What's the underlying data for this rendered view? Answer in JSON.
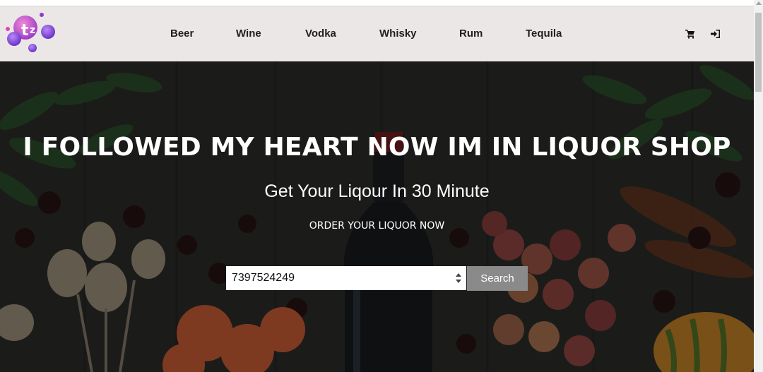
{
  "nav": {
    "links": [
      "Beer",
      "Wine",
      "Vodka",
      "Whisky",
      "Rum",
      "Tequila"
    ],
    "cart_icon": "shopping-cart-icon",
    "login_icon": "sign-in-icon"
  },
  "hero": {
    "title": "I FOLLOWED MY HEART NOW IM IN LIQUOR SHOP",
    "subtitle": "Get Your Liqour In 30 Minute",
    "cta": "ORDER YOUR LIQUOR NOW"
  },
  "search": {
    "value": "7397524249",
    "button_label": "Search"
  },
  "colors": {
    "navbar_bg": "#ece7e7",
    "button_bg": "#8a8a8a",
    "logo_pink": "#d64bb4",
    "logo_purple": "#8e3bd1"
  }
}
